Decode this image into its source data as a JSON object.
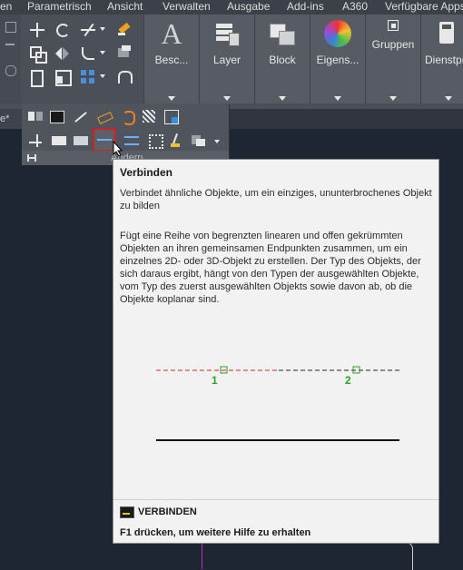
{
  "menu": {
    "items": [
      "en",
      "Parametrisch",
      "Ansicht",
      "Verwalten",
      "Ausgabe",
      "Add-ins",
      "A360",
      "Verfügbare Apps"
    ]
  },
  "ribbon": {
    "buttons": [
      {
        "label": "Besc..."
      },
      {
        "label": "Layer"
      },
      {
        "label": "Block"
      },
      {
        "label": "Eigens..."
      },
      {
        "label": "Gruppen"
      },
      {
        "label": "Dienstpr"
      }
    ]
  },
  "file_tab": {
    "label": "e*"
  },
  "panel": {
    "label": "Ändern"
  },
  "tooltip": {
    "title": "Verbinden",
    "summary": "Verbindet ähnliche Objekte, um ein einziges, ununterbrochenes Objekt zu bilden",
    "details": "Fügt eine Reihe von begrenzten linearen und offen gekrümmten Objekten an ihren gemeinsamen Endpunkten zusammen, um ein einzelnes 2D- oder 3D-Objekt zu erstellen. Der Typ des Objekts, der sich daraus ergibt, hängt von den Typen der ausgewählten Objekte, vom Typ des zuerst ausgewählten Objekts sowie davon ab, ob die Objekte koplanar sind.",
    "marker1": "1",
    "marker2": "2",
    "command": "VERBINDEN",
    "help": "F1 drücken, um weitere Hilfe zu erhalten"
  },
  "colors": {
    "menu_bg": "#3b4049",
    "ribbon_bg": "#4a4f58",
    "drawing_bg": "#1f2633",
    "tooltip_bg": "#f2f2f2",
    "highlight_red": "#d22020",
    "marker_green": "#2aa12a"
  }
}
